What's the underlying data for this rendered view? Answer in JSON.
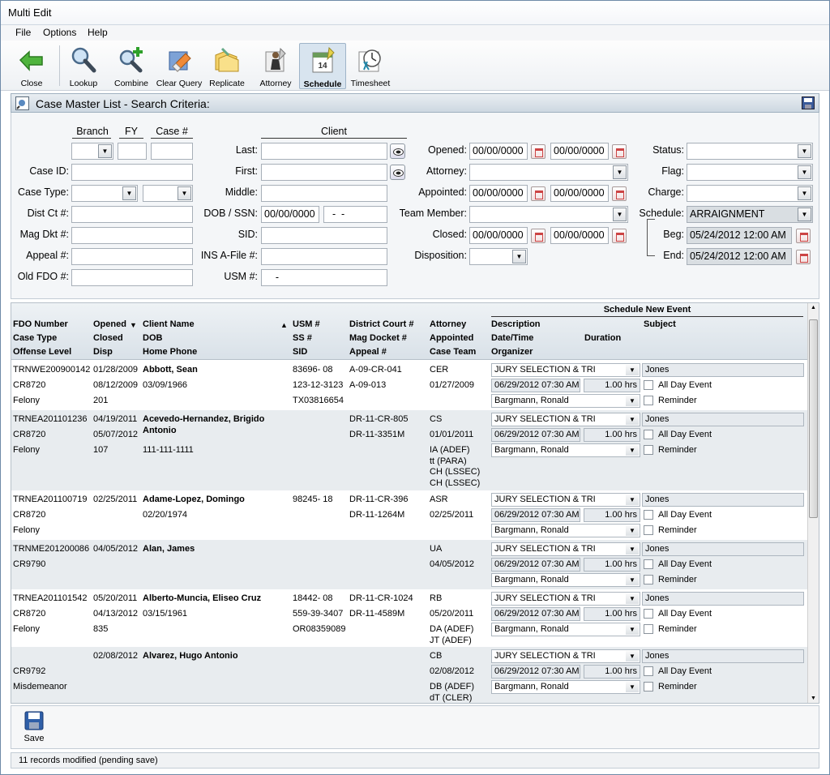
{
  "window": {
    "title": "Multi Edit"
  },
  "menu": [
    "File",
    "Options",
    "Help"
  ],
  "toolbar": [
    {
      "label": "Close",
      "icon": "back-arrow-icon"
    },
    {
      "label": "Lookup",
      "icon": "magnifier-icon"
    },
    {
      "label": "Combine",
      "icon": "magnifier-plus-icon"
    },
    {
      "label": "Clear Query",
      "icon": "eraser-icon"
    },
    {
      "label": "Replicate",
      "icon": "folders-icon"
    },
    {
      "label": "Attorney",
      "icon": "attorney-icon"
    },
    {
      "label": "Schedule",
      "icon": "calendar-icon",
      "active": true
    },
    {
      "label": "Timesheet",
      "icon": "timesheet-icon"
    }
  ],
  "search": {
    "title": "Case Master List - Search Criteria:",
    "headers": {
      "branch": "Branch",
      "fy": "FY",
      "case_no": "Case #",
      "client": "Client"
    },
    "labels": {
      "case_id": "Case ID:",
      "case_type": "Case Type:",
      "dist_ct": "Dist Ct #:",
      "mag_dkt": "Mag Dkt #:",
      "appeal": "Appeal #:",
      "old_fdo": "Old FDO #:",
      "last": "Last:",
      "first": "First:",
      "middle": "Middle:",
      "dob_ssn": "DOB / SSN:",
      "sid": "SID:",
      "ins": "INS A-File #:",
      "usm": "USM #:",
      "opened": "Opened:",
      "attorney": "Attorney:",
      "appointed": "Appointed:",
      "team": "Team Member:",
      "closed": "Closed:",
      "disposition": "Disposition:",
      "status": "Status:",
      "flag": "Flag:",
      "charge": "Charge:",
      "schedule": "Schedule:",
      "beg": "Beg:",
      "end": "End:"
    },
    "values": {
      "dob": "00/00/0000",
      "ssn": "  -  -",
      "usm": "    -",
      "opened_from": "00/00/0000",
      "opened_to": "00/00/0000",
      "appointed_from": "00/00/0000",
      "appointed_to": "00/00/0000",
      "closed_from": "00/00/0000",
      "closed_to": "00/00/0000",
      "schedule": "ARRAIGNMENT",
      "beg": "05/24/2012 12:00 AM",
      "end": "05/24/2012 12:00 AM"
    }
  },
  "grid": {
    "headers": {
      "c1": [
        "FDO Number",
        "Case Type",
        "Offense Level"
      ],
      "c2": [
        "Opened",
        "Closed",
        "Disp"
      ],
      "c3": [
        "Client Name",
        "DOB",
        "Home Phone"
      ],
      "c4": [
        "USM #",
        "SS #",
        "SID"
      ],
      "c5": [
        "District Court #",
        "Mag Docket #",
        "Appeal #"
      ],
      "c6": [
        "Attorney",
        "Appointed",
        "Case Team"
      ],
      "schedule_new_event": "Schedule New Event",
      "description": "Description",
      "subject": "Subject",
      "date_time": "Date/Time",
      "duration": "Duration",
      "organizer": "Organizer"
    },
    "rows": [
      {
        "c1": [
          "TRNWE200900142",
          "CR8720",
          "Felony"
        ],
        "c2": [
          "01/28/2009",
          "08/12/2009",
          "201"
        ],
        "c3": [
          "Abbott, Sean",
          "03/09/1966",
          ""
        ],
        "c4": [
          "83696- 08",
          "123-12-3123",
          "TX03816654"
        ],
        "c5": [
          "A-09-CR-041",
          "A-09-013",
          ""
        ],
        "c6": [
          "CER",
          "01/27/2009"
        ],
        "desc": "JURY SELECTION & TRI",
        "subject": "Jones",
        "datetime": "06/29/2012 07:30 AM",
        "dur": "1.00 hrs",
        "org": "Bargmann, Ronald",
        "allday": "All Day Event",
        "reminder": "Reminder"
      },
      {
        "c1": [
          "TRNEA201101236",
          "CR8720",
          "Felony"
        ],
        "c2": [
          "04/19/2011",
          "05/07/2012",
          "107"
        ],
        "c3": [
          "Acevedo-Hernandez, Brigido",
          "Antonio",
          "111-111-1111"
        ],
        "c4": [
          "",
          "",
          ""
        ],
        "c5": [
          "DR-11-CR-805",
          "DR-11-3351M",
          ""
        ],
        "c6": [
          "CS",
          "01/01/2011",
          "IA (ADEF)",
          "tt (PARA)",
          "CH (LSSEC)",
          "CH (LSSEC)"
        ],
        "desc": "JURY SELECTION & TRI",
        "subject": "Jones",
        "datetime": "06/29/2012 07:30 AM",
        "dur": "1.00 hrs",
        "org": "Bargmann, Ronald",
        "allday": "All Day Event",
        "reminder": "Reminder"
      },
      {
        "c1": [
          "TRNEA201100719",
          "CR8720",
          "Felony"
        ],
        "c2": [
          "02/25/2011",
          "",
          ""
        ],
        "c3": [
          "Adame-Lopez, Domingo",
          "02/20/1974",
          ""
        ],
        "c4": [
          "98245- 18",
          "",
          ""
        ],
        "c5": [
          "DR-11-CR-396",
          "DR-11-1264M",
          ""
        ],
        "c6": [
          "ASR",
          "02/25/2011"
        ],
        "desc": "JURY SELECTION & TRI",
        "subject": "Jones",
        "datetime": "06/29/2012 07:30 AM",
        "dur": "1.00 hrs",
        "org": "Bargmann, Ronald",
        "allday": "All Day Event",
        "reminder": "Reminder"
      },
      {
        "c1": [
          "TRNME201200086",
          "CR9790",
          ""
        ],
        "c2": [
          "04/05/2012",
          "",
          ""
        ],
        "c3": [
          "Alan, James",
          "",
          ""
        ],
        "c4": [
          "",
          "",
          ""
        ],
        "c5": [
          "",
          "",
          ""
        ],
        "c6": [
          "UA",
          "04/05/2012"
        ],
        "desc": "JURY SELECTION & TRI",
        "subject": "Jones",
        "datetime": "06/29/2012 07:30 AM",
        "dur": "1.00 hrs",
        "org": "Bargmann, Ronald",
        "allday": "All Day Event",
        "reminder": "Reminder"
      },
      {
        "c1": [
          "TRNEA201101542",
          "CR8720",
          "Felony"
        ],
        "c2": [
          "05/20/2011",
          "04/13/2012",
          "835"
        ],
        "c3": [
          "Alberto-Muncia, Eliseo Cruz",
          "03/15/1961",
          ""
        ],
        "c4": [
          "18442- 08",
          "559-39-3407",
          "OR08359089"
        ],
        "c5": [
          "DR-11-CR-1024",
          "DR-11-4589M",
          ""
        ],
        "c6": [
          "RB",
          "05/20/2011",
          "DA (ADEF)",
          "JT (ADEF)"
        ],
        "desc": "JURY SELECTION & TRI",
        "subject": "Jones",
        "datetime": "06/29/2012 07:30 AM",
        "dur": "1.00 hrs",
        "org": "Bargmann, Ronald",
        "allday": "All Day Event",
        "reminder": "Reminder"
      },
      {
        "c1": [
          "",
          "CR9792",
          "Misdemeanor"
        ],
        "c2": [
          "02/08/2012",
          "",
          ""
        ],
        "c3": [
          "Alvarez, Hugo Antonio",
          "",
          ""
        ],
        "c4": [
          "",
          "",
          ""
        ],
        "c5": [
          "",
          "",
          ""
        ],
        "c6": [
          "CB",
          "02/08/2012",
          "DB (ADEF)",
          "dT (CLER)"
        ],
        "desc": "JURY SELECTION & TRI",
        "subject": "Jones",
        "datetime": "06/29/2012 07:30 AM",
        "dur": "1.00 hrs",
        "org": "Bargmann, Ronald",
        "allday": "All Day Event",
        "reminder": "Reminder"
      }
    ]
  },
  "save": {
    "label": "Save"
  },
  "status": {
    "text": "11 records modified (pending save)"
  },
  "colors": {
    "row_alt": "#e8ecef",
    "accent": "#d8e4ef",
    "arrow_green": "#3aa02d"
  }
}
